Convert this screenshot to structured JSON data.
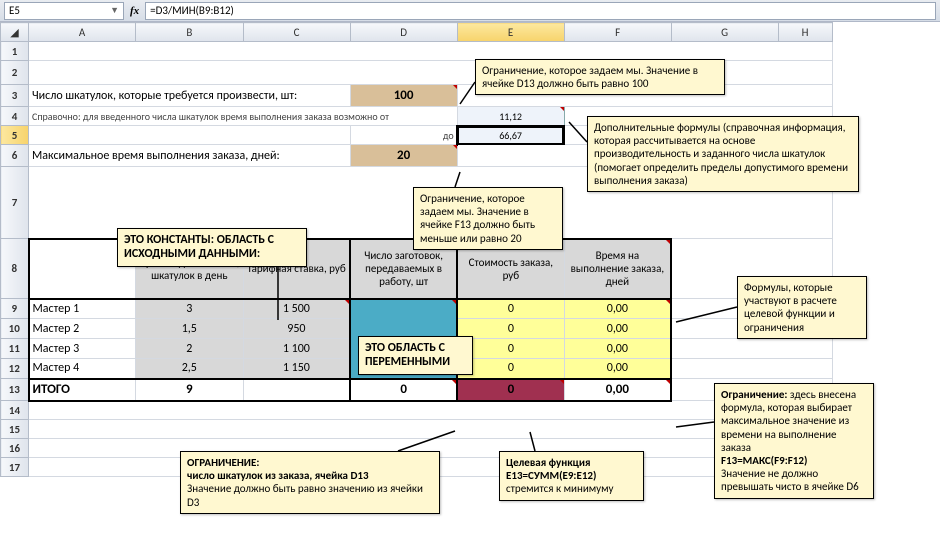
{
  "cellRef": "E5",
  "formula": "=D3/МИН(B9:B12)",
  "cols": [
    "A",
    "B",
    "C",
    "D",
    "E",
    "F",
    "G",
    "H"
  ],
  "rows": [
    "1",
    "2",
    "3",
    "4",
    "5",
    "6",
    "7",
    "8",
    "9",
    "10",
    "11",
    "12",
    "13",
    "14",
    "15",
    "16",
    "17"
  ],
  "r3a": "Число шкатулок, которые требуется произвести, шт:",
  "r3d": "100",
  "r4a": "Справочно: для введенного числа шкатулок время выполнения заказа возможно от",
  "r4e": "11,12",
  "r5d": "до",
  "r5e": "66,67",
  "r6a": "Максимальное время выполнения заказа, дней:",
  "r6d": "20",
  "hdrB": "Производительность, шкатулок в день",
  "hdrC": "Тарифная ставка, руб",
  "hdrD": "Число заготовок, передаваемых в работу, шт",
  "hdrE": "Стоимость заказа, руб",
  "hdrF": "Время на выполнение заказа, дней",
  "m1": "Мастер 1",
  "m2": "Мастер 2",
  "m3": "Мастер 3",
  "m4": "Мастер 4",
  "b9": "3",
  "b10": "1,5",
  "b11": "2",
  "b12": "2,5",
  "c9": "1 500",
  "c10": "950",
  "c11": "1 100",
  "c12": "1 150",
  "e9": "0",
  "e10": "0",
  "e11": "0",
  "e12": "0",
  "f9": "0,00",
  "f10": "0,00",
  "f11": "0,00",
  "f12": "0,00",
  "totlbl": "ИТОГО",
  "b13": "9",
  "d13": "0",
  "e13": "0",
  "f13": "0,00",
  "note1": "Ограничение, которое задаем мы. Значение в ячейке D13 должно быть равно 100",
  "note2": "Дополнительные формулы (справочная информация, которая рассчитывается на основе производительность и заданного числа шкатулок (помогает определить пределы допустимого времени выполнения заказа)",
  "note3": "Ограничение, которое задаем мы. Значение в ячейке F13 должно быть меньше или равно 20",
  "note4": "ЭТО КОНСТАНТЫ: ОБЛАСТЬ С ИСХОДНЫМИ ДАННЫМИ:",
  "note5": "ЭТО ОБЛАСТЬ С ПЕРЕМЕННЫМИ",
  "note6": "Формулы, которые участвуют в расчете целевой функции и ограничения",
  "note7t": "ОГРАНИЧЕНИЕ:",
  "note7s": "число шкатулок из заказа, ячейка D13",
  "note7b": "Значение должно быть равно значению из ячейки D3",
  "note8t": "Целевая функция Е13=СУММ(Е9:Е12)",
  "note8b": "стремится к минимуму",
  "note9a": "Ограничение:",
  "note9b": " здесь внесена формула, которая выбирает максимальное значение из времени на выполнение заказа",
  "note9c": "F13=МАКС(F9:F12)",
  "note9d": "Значение не должно превышать чисто в ячейке D6"
}
